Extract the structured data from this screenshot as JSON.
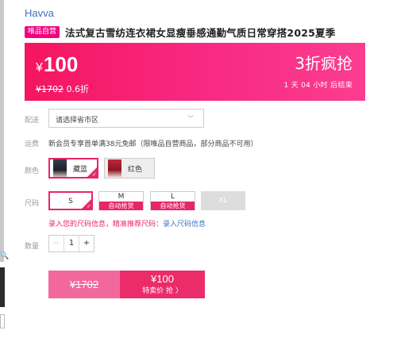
{
  "brand": "Havva",
  "product": {
    "badge": "唯品自营",
    "title": "法式复古雪纺连衣裙女显瘦垂感通勤气质日常穿搭2025夏季"
  },
  "price": {
    "yen": "¥",
    "current": "100",
    "original": "¥1702",
    "discount": "0.6折",
    "promo_title": "3折疯抢",
    "promo_countdown": "1 天 04 小时 后结束"
  },
  "delivery": {
    "label": "配送",
    "placeholder": "请选择省市区",
    "chevron_icon": "chevron-down-icon"
  },
  "shipping": {
    "label": "运费",
    "text": "新会员专享首单满38元免邮（限唯品自营商品，部分商品不可用）"
  },
  "color": {
    "label": "颜色",
    "options": [
      {
        "label": "藏蓝",
        "selected": true
      },
      {
        "label": "红色",
        "selected": false
      }
    ]
  },
  "size": {
    "label": "尺码",
    "options": [
      {
        "size": "S",
        "tag": "",
        "state": "selected"
      },
      {
        "size": "M",
        "tag": "自动抢货",
        "state": "normal"
      },
      {
        "size": "L",
        "tag": "自动抢货",
        "state": "normal"
      },
      {
        "size": "XL",
        "tag": "",
        "state": "disabled"
      }
    ],
    "hint": "录入您的尺码信息，精准推荐尺码：",
    "hint_link": "录入尺码信息"
  },
  "quantity": {
    "label": "数量",
    "minus": "−",
    "value": "1",
    "plus": "+"
  },
  "buy": {
    "old_price": "¥1702",
    "new_price": "¥100",
    "action": "特卖价 抢 〉"
  },
  "colors": {
    "accent": "#e8256b",
    "banner_start": "#f5155f",
    "banner_end": "#fb3d8f",
    "brand_link": "#3d6fc3"
  }
}
